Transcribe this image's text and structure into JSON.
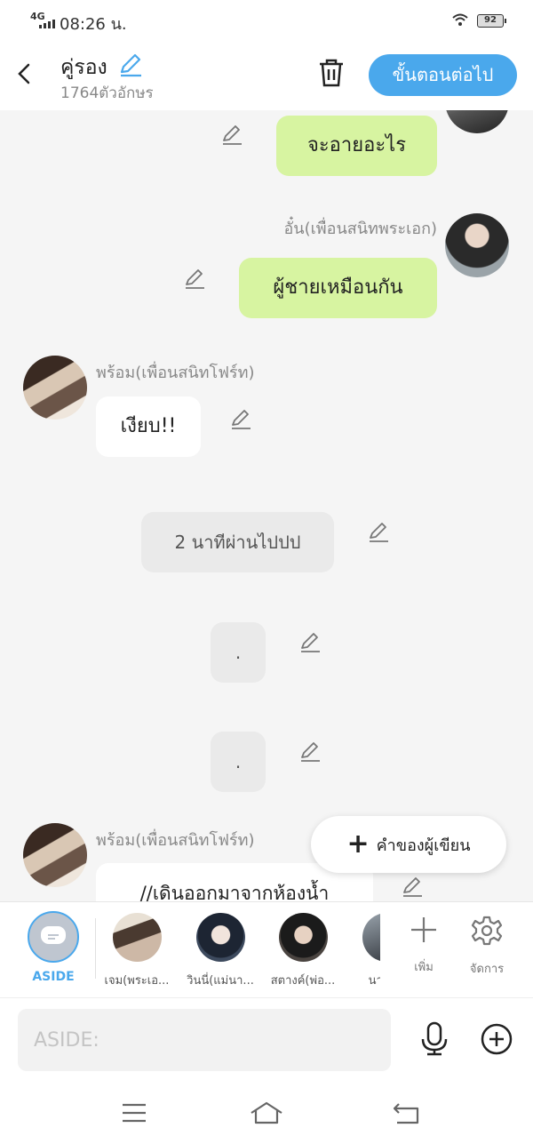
{
  "status": {
    "network": "4G",
    "time": "08:26 น.",
    "battery": "92"
  },
  "header": {
    "title": "คู่รอง",
    "char_count": "1764ตัวอักษร",
    "next_label": "ขั้นตอนต่อไป"
  },
  "messages": [
    {
      "text": "จะอายอะไร"
    },
    {
      "sender": "อั๋น(เพื่อนสนิทพระเอก)",
      "text": "ผู้ชายเหมือนกัน"
    },
    {
      "sender": "พร้อม(เพื่อนสนิทโฟร์ท)",
      "text": "เงียบ!!"
    },
    {
      "text": "2 นาทีผ่านไปปป"
    },
    {
      "text": "."
    },
    {
      "text": "."
    },
    {
      "sender": "พร้อม(เพื่อนสนิทโฟร์ท)",
      "text": "//เดินออกมาจากห้องน้ำ"
    }
  ],
  "fab": {
    "label": "คำของผู้เขียน"
  },
  "charbar": {
    "aside_label": "ASIDE",
    "characters": [
      {
        "label": "เจม(พระเอ..."
      },
      {
        "label": "วินนี่(แม่นา..."
      },
      {
        "label": "สตางค์(พ่อ..."
      },
      {
        "label": "นายเ..."
      }
    ],
    "add_label": "เพิ่ม",
    "manage_label": "จัดการ"
  },
  "input": {
    "placeholder": "ASIDE:"
  },
  "colors": {
    "accent": "#4aa8ec",
    "bubble_green": "#d7f4a1"
  }
}
